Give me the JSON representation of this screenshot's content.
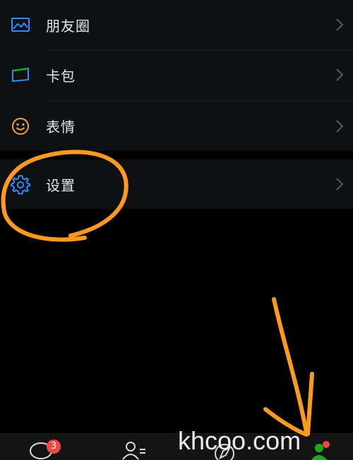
{
  "menu": {
    "items": [
      {
        "label": "朋友圈",
        "icon": "album-icon"
      },
      {
        "label": "卡包",
        "icon": "card-wallet-icon"
      },
      {
        "label": "表情",
        "icon": "smiley-icon"
      }
    ],
    "settings": {
      "label": "设置",
      "icon": "gear-icon"
    }
  },
  "tabbar": {
    "chats_badge": "3",
    "tabs": [
      {
        "name": "chats",
        "icon": "chat-bubble-icon"
      },
      {
        "name": "contacts",
        "icon": "contacts-icon"
      },
      {
        "name": "discover",
        "icon": "compass-icon"
      },
      {
        "name": "me",
        "icon": "person-icon"
      }
    ]
  },
  "watermark": "khcoo.com",
  "colors": {
    "accent_blue": "#2f8cff",
    "smiley_orange": "#f0a040",
    "annotation_orange": "#ff9a1f",
    "me_tab_green": "#1aad19",
    "badge_red": "#f04646",
    "row_bg": "#0f1012"
  }
}
